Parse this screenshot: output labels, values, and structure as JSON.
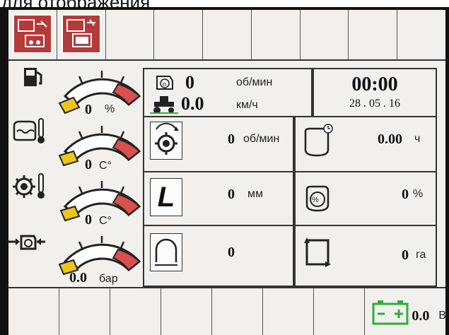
{
  "caption": "для отображения",
  "gauges": [
    {
      "icon": "fuel-pump-icon",
      "value": "0",
      "unit": "%",
      "level_fraction": 0.0
    },
    {
      "icon": "coolant-temperature-icon",
      "value": "0",
      "unit": "C°",
      "level_fraction": 0.0
    },
    {
      "icon": "oil-temperature-icon",
      "value": "0",
      "unit": "C°",
      "level_fraction": 0.0
    },
    {
      "icon": "oil-pressure-icon",
      "value": "0.0",
      "unit": "бар",
      "level_fraction": 0.0
    }
  ],
  "engine": {
    "rpm_value": "0",
    "rpm_unit": "об/мин",
    "speed_value": "0.0",
    "speed_unit": "км/ч"
  },
  "clock": {
    "time": "00:00",
    "date": "28 . 05 . 16"
  },
  "readouts": {
    "pto": {
      "icon": "pto-shaft-icon",
      "value": "0",
      "unit": "об/мин"
    },
    "engine_hours": {
      "icon": "engine-hours-icon",
      "value": "0.00",
      "unit": "ч"
    },
    "hitch": {
      "icon": "hitch-position-icon",
      "letter": "L",
      "value": "0",
      "unit": "мм"
    },
    "slip": {
      "icon": "wheel-slip-icon",
      "value": "0",
      "unit": "%"
    },
    "arch": {
      "icon": "arch-icon",
      "value": "0",
      "unit": ""
    },
    "area": {
      "icon": "area-icon",
      "value": "0",
      "unit": "га"
    }
  },
  "battery": {
    "icon": "battery-icon",
    "value": "0.0",
    "unit": "В"
  },
  "colors": {
    "accent_red": "#b53b3b",
    "gauge_red": "#d9504f",
    "gauge_yellow": "#f0c419",
    "battery_green": "#2fae3a"
  }
}
